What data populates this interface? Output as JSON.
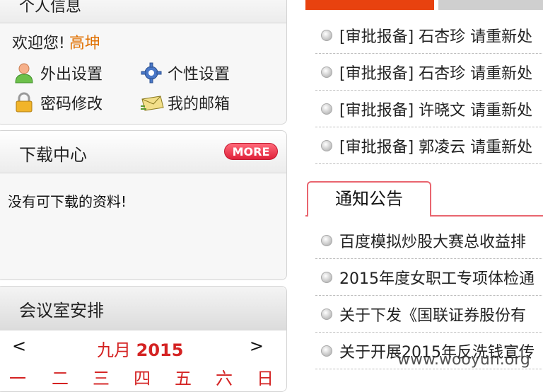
{
  "info_panel": {
    "title": "个人信息",
    "welcome_prefix": "欢迎您!",
    "user_name": "高坤",
    "links": {
      "outing": "外出设置",
      "personal": "个性设置",
      "password": "密码修改",
      "mailbox": "我的邮箱"
    }
  },
  "download_panel": {
    "title": "下载中心",
    "more_label": "MORE",
    "empty_message": "没有可下载的资料!"
  },
  "meeting_panel": {
    "title": "会议室安排",
    "prev": "<",
    "next": ">",
    "month": "九月",
    "year": "2015",
    "weekdays": [
      "一",
      "二",
      "三",
      "四",
      "五",
      "六",
      "日"
    ]
  },
  "approvals": [
    "[审批报备] 石杏珍 请重新处",
    "[审批报备] 石杏珍 请重新处",
    "[审批报备] 许晓文 请重新处",
    "[审批报备] 郭凌云 请重新处"
  ],
  "notice_tab_label": "通知公告",
  "notices": [
    "百度模拟炒股大赛总收益排",
    "2015年度女职工专项体检通",
    "关于下发《国联证券股份有",
    "关于开展2015年反洗钱宣传"
  ],
  "watermark": "www.wooyun.org",
  "colors": {
    "accent_orange": "#e8420f",
    "user_name": "#e07000",
    "calendar_red": "#d42222",
    "notice_border": "#e9656f"
  },
  "icons": {
    "outing": "person-icon",
    "personal": "gear-icon",
    "password": "lock-icon",
    "mailbox": "envelope-icon",
    "bullet": "circle-bullet-icon"
  }
}
